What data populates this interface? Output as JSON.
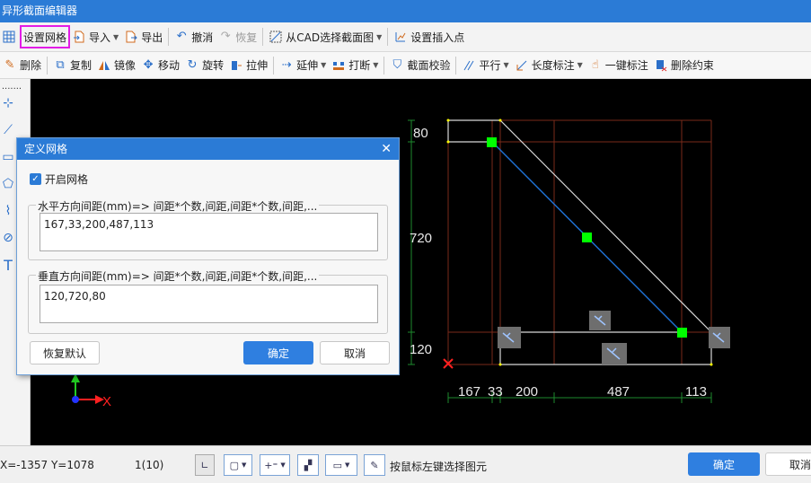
{
  "window": {
    "title": "异形截面编辑器"
  },
  "toolbar1": {
    "set_grid": "设置网格",
    "import": "导入",
    "export": "导出",
    "undo": "撤消",
    "redo": "恢复",
    "select_from_cad": "从CAD选择截面图",
    "set_insert_point": "设置插入点"
  },
  "toolbar2": {
    "delete": "删除",
    "copy": "复制",
    "mirror": "镜像",
    "move": "移动",
    "rotate": "旋转",
    "stretch": "拉伸",
    "extend": "延伸",
    "break": "打断",
    "section_check": "截面校验",
    "parallel": "平行",
    "length_dim": "长度标注",
    "one_click_dim": "一键标注",
    "delete_constraint": "删除约束"
  },
  "canvas": {
    "dim_top": "80",
    "dim_mid": "720",
    "dim_bottom": "120",
    "dim_x": [
      "167",
      "33",
      "200",
      "487",
      "113"
    ],
    "axis_x_label": "X"
  },
  "dialog": {
    "title": "定义网格",
    "enable_grid_label": "开启网格",
    "enable_grid_checked": true,
    "horizontal_label": "水平方向间距(mm)=> 间距*个数,间距,间距*个数,间距,...",
    "horizontal_value": "167,33,200,487,113",
    "vertical_label": "垂直方向间距(mm)=> 间距*个数,间距,间距*个数,间距,...",
    "vertical_value": "120,720,80",
    "restore_default": "恢复默认",
    "ok": "确定",
    "cancel": "取消"
  },
  "status": {
    "coordinates": "X=-1357 Y=1078",
    "layer_info": "1(10)",
    "hint": "按鼠标左键选择图元",
    "ok": "确定",
    "cancel": "取消"
  },
  "colors": {
    "accent": "#2b7bd6",
    "highlight": "#e21ce6",
    "grid_line": "#7a2a1a",
    "dim_line": "#1e8a2e",
    "node": "#00ff00",
    "member": "#1e6fd0"
  }
}
